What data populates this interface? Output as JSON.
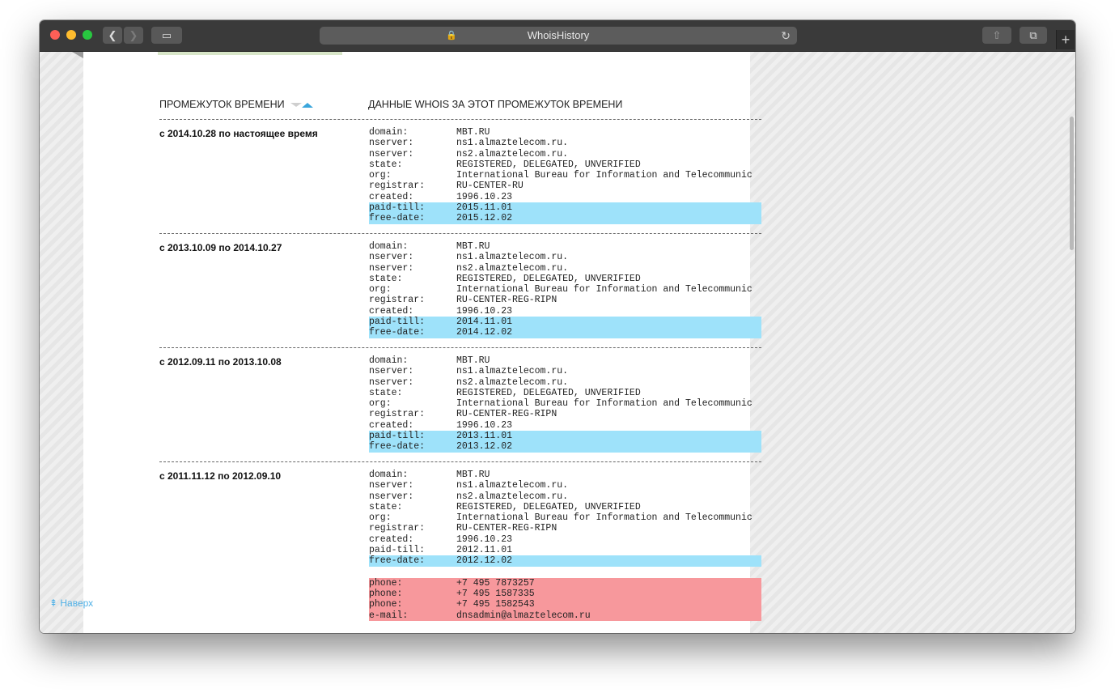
{
  "browser": {
    "title": "WhoisHistory",
    "back_glyph": "❮",
    "forward_glyph": "❯",
    "sidebar_glyph": "▭",
    "lock_glyph": "🔒",
    "reload_glyph": "↻",
    "share_glyph": "⇧",
    "tabs_glyph": "⧉",
    "newtab_glyph": "+"
  },
  "table": {
    "col_period": "ПРОМЕЖУТОК ВРЕМЕНИ",
    "col_data": "ДАННЫЕ WHOIS ЗА ЭТОТ ПРОМЕЖУТОК ВРЕМЕНИ"
  },
  "records": [
    {
      "period": "с 2014.10.28 по настоящее время",
      "lines": [
        {
          "k": "domain:",
          "v": "MBT.RU"
        },
        {
          "k": "nserver:",
          "v": "ns1.almaztelecom.ru."
        },
        {
          "k": "nserver:",
          "v": "ns2.almaztelecom.ru."
        },
        {
          "k": "state:",
          "v": "REGISTERED, DELEGATED, UNVERIFIED"
        },
        {
          "k": "org:",
          "v": "International Bureau for Information and Telecommunic"
        },
        {
          "k": "registrar:",
          "v": "RU-CENTER-RU"
        },
        {
          "k": "created:",
          "v": "1996.10.23"
        },
        {
          "k": "paid-till:",
          "v": "2015.11.01"
        },
        {
          "k": "free-date:",
          "v": "2015.12.02"
        }
      ]
    },
    {
      "period": "с 2013.10.09 по 2014.10.27",
      "lines": [
        {
          "k": "domain:",
          "v": "MBT.RU"
        },
        {
          "k": "nserver:",
          "v": "ns1.almaztelecom.ru."
        },
        {
          "k": "nserver:",
          "v": "ns2.almaztelecom.ru."
        },
        {
          "k": "state:",
          "v": "REGISTERED, DELEGATED, UNVERIFIED"
        },
        {
          "k": "org:",
          "v": "International Bureau for Information and Telecommunic"
        },
        {
          "k": "registrar:",
          "v": "RU-CENTER-REG-RIPN"
        },
        {
          "k": "created:",
          "v": "1996.10.23"
        },
        {
          "k": "paid-till:",
          "v": "2014.11.01"
        },
        {
          "k": "free-date:",
          "v": "2014.12.02"
        }
      ]
    },
    {
      "period": "с 2012.09.11 по 2013.10.08",
      "lines": [
        {
          "k": "domain:",
          "v": "MBT.RU"
        },
        {
          "k": "nserver:",
          "v": "ns1.almaztelecom.ru."
        },
        {
          "k": "nserver:",
          "v": "ns2.almaztelecom.ru."
        },
        {
          "k": "state:",
          "v": "REGISTERED, DELEGATED, UNVERIFIED"
        },
        {
          "k": "org:",
          "v": "International Bureau for Information and Telecommunic"
        },
        {
          "k": "registrar:",
          "v": "RU-CENTER-REG-RIPN"
        },
        {
          "k": "created:",
          "v": "1996.10.23"
        },
        {
          "k": "paid-till:",
          "v": "2013.11.01"
        },
        {
          "k": "free-date:",
          "v": "2013.12.02"
        }
      ]
    },
    {
      "period": "с 2011.11.12 по 2012.09.10",
      "lines": [
        {
          "k": "domain:",
          "v": "MBT.RU"
        },
        {
          "k": "nserver:",
          "v": "ns1.almaztelecom.ru."
        },
        {
          "k": "nserver:",
          "v": "ns2.almaztelecom.ru."
        },
        {
          "k": "state:",
          "v": "REGISTERED, DELEGATED, UNVERIFIED"
        },
        {
          "k": "org:",
          "v": "International Bureau for Information and Telecommunic"
        },
        {
          "k": "registrar:",
          "v": "RU-CENTER-REG-RIPN"
        },
        {
          "k": "created:",
          "v": "1996.10.23"
        },
        {
          "k": "paid-till:",
          "v": "2012.11.01"
        },
        {
          "k": "free-date:",
          "v": "2012.12.02"
        },
        {
          "k": "phone:",
          "v": "+7 495 7873257"
        },
        {
          "k": "phone:",
          "v": "+7 495 1587335"
        },
        {
          "k": "phone:",
          "v": "+7 495 1582543"
        },
        {
          "k": "e-mail:",
          "v": "dnsadmin@almaztelecom.ru"
        }
      ]
    }
  ],
  "footer": {
    "back_to_top": "⇞ Наверх"
  },
  "colors": {
    "highlight_changed": "#9ee2fa",
    "highlight_contact": "#f7989c",
    "link": "#4fb0e6"
  }
}
